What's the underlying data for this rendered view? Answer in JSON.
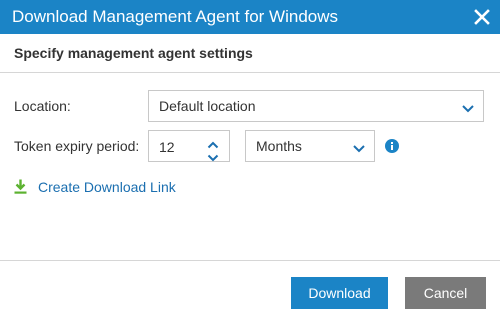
{
  "window": {
    "title": "Download Management Agent for Windows",
    "close_icon": "close-icon"
  },
  "header": {
    "subtitle": "Specify management agent settings"
  },
  "form": {
    "location_label": "Location:",
    "location_value": "Default location",
    "token_label": "Token expiry period:",
    "token_value": "12",
    "token_unit": "Months",
    "info_icon": "info-icon"
  },
  "link": {
    "label": "Create Download Link",
    "icon": "download-icon"
  },
  "buttons": {
    "download": "Download",
    "cancel": "Cancel"
  },
  "colors": {
    "accent": "#1b84c6",
    "link": "#1b6fb0",
    "download_icon": "#5cb230",
    "cancel_bg": "#7a7a7a"
  }
}
